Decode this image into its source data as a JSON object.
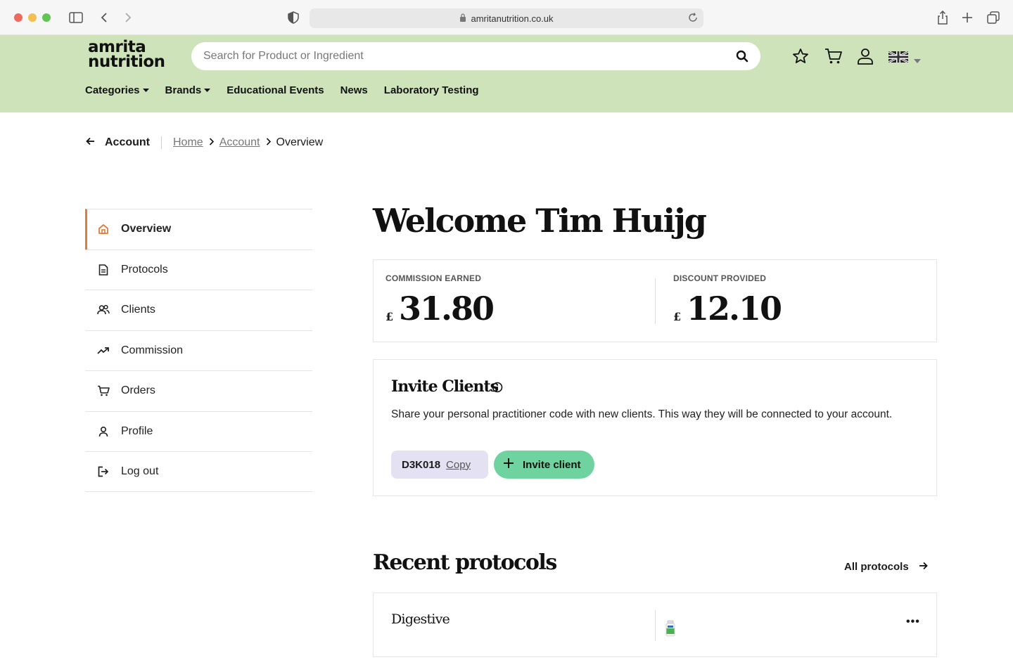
{
  "browser": {
    "url": "amritanutrition.co.uk"
  },
  "header": {
    "logo_line1": "amrita",
    "logo_line2": "nutrition",
    "search_placeholder": "Search for Product or Ingredient",
    "nav": [
      {
        "label": "Categories",
        "has_caret": true
      },
      {
        "label": "Brands",
        "has_caret": true
      },
      {
        "label": "Educational Events",
        "has_caret": false
      },
      {
        "label": "News",
        "has_caret": false
      },
      {
        "label": "Laboratory Testing",
        "has_caret": false
      }
    ],
    "bg_color": "#cfe3bb"
  },
  "breadcrumb": {
    "back_label": "Account",
    "items": [
      "Home",
      "Account",
      "Overview"
    ]
  },
  "sidebar": {
    "items": [
      {
        "label": "Overview",
        "icon": "home-icon",
        "active": true
      },
      {
        "label": "Protocols",
        "icon": "document-icon",
        "active": false
      },
      {
        "label": "Clients",
        "icon": "users-icon",
        "active": false
      },
      {
        "label": "Commission",
        "icon": "trend-up-icon",
        "active": false
      },
      {
        "label": "Orders",
        "icon": "cart-icon",
        "active": false
      },
      {
        "label": "Profile",
        "icon": "user-icon",
        "active": false
      },
      {
        "label": "Log out",
        "icon": "logout-icon",
        "active": false
      }
    ],
    "accent_color": "#e07b39"
  },
  "main": {
    "welcome": "Welcome Tim Huijg",
    "stats": [
      {
        "label": "COMMISSION EARNED",
        "currency": "£",
        "value": "31.80"
      },
      {
        "label": "DISCOUNT PROVIDED",
        "currency": "£",
        "value": "12.10"
      }
    ],
    "invite": {
      "title": "Invite Clients",
      "description": "Share your personal practitioner code with new clients. This way they will be connected to your account.",
      "code": "D3K018",
      "copy_label": "Copy",
      "button_label": "Invite client",
      "button_color": "#6fd39f",
      "code_bg": "#e4e2f2"
    },
    "recent": {
      "title": "Recent protocols",
      "all_link": "All protocols",
      "protocols": [
        {
          "name": "Digestive",
          "more": "•••"
        }
      ]
    }
  }
}
